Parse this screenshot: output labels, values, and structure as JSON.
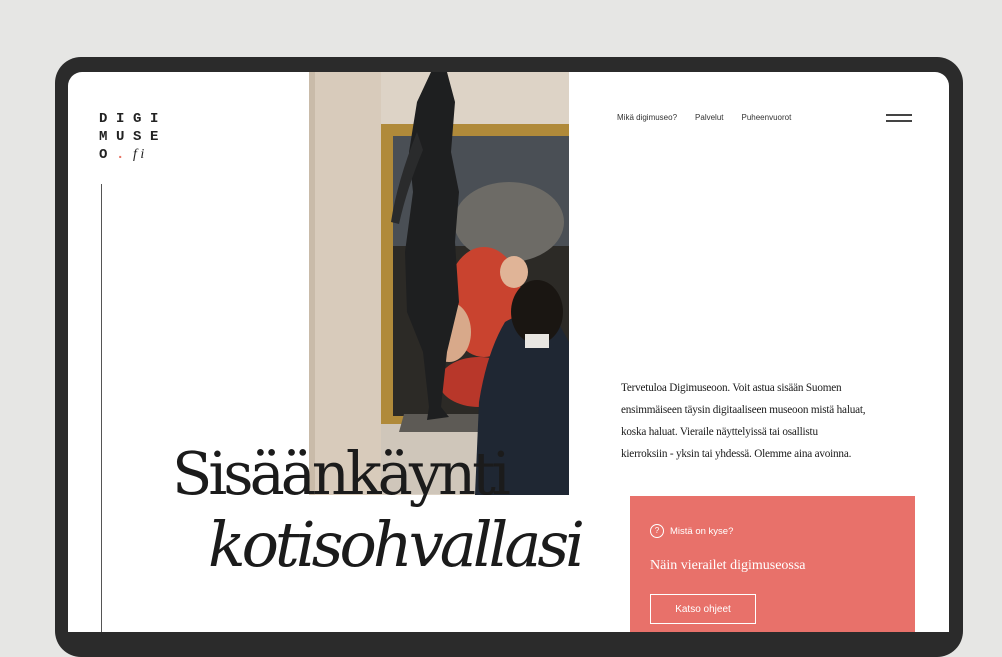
{
  "logo": {
    "row1": [
      "D",
      "I",
      "G",
      "I"
    ],
    "row2": [
      "M",
      "U",
      "S",
      "E"
    ],
    "row3_letter": "O",
    "row3_dot": ".",
    "row3_tail": "f i"
  },
  "nav": {
    "items": [
      "Mikä digimuseo?",
      "Palvelut",
      "Puheenvuorot"
    ]
  },
  "intro": "Tervetuloa Digimuseoon. Voit astua sisään Suomen ensimmäiseen täysin digitaaliseen museoon mistä haluat, koska haluat. Vieraile näyttelyissä tai osallistu kierroksiin - yksin tai yhdessä. Olemme aina avoinna.",
  "headline": {
    "line1": "Sisäänkäynti",
    "line2": "kotisohvallasi"
  },
  "card": {
    "question": "Mistä on kyse?",
    "heading": "Näin vierailet digimuseossa",
    "button": "Katso ohjeet"
  },
  "colors": {
    "accent": "#e8716a",
    "frame": "#2b2b2b",
    "background": "#e6e6e4"
  },
  "icons": [
    "menu-icon",
    "question-icon"
  ]
}
